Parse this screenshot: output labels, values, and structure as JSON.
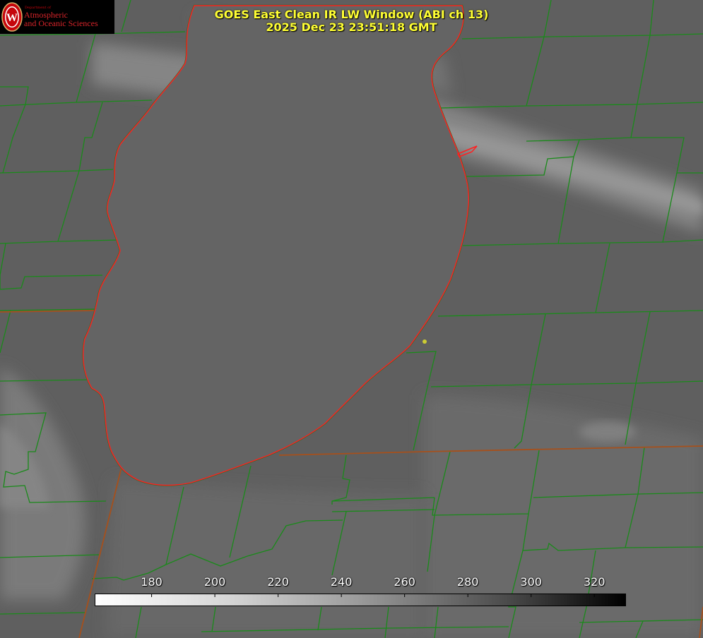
{
  "title": {
    "line1": "GOES East Clean IR LW Window (ABI ch 13)",
    "line2": "2025 Dec 23 23:51:18 GMT"
  },
  "logo": {
    "department": "Department of",
    "line1": "Atmospheric",
    "line2": "and Oceanic Sciences",
    "seal_letter": "W"
  },
  "colors": {
    "background_gray": "#5e5e5e",
    "county_lines": "#1a8a1a",
    "state_lines": "#b04a1a",
    "lake_outline": "#ff2020",
    "title_text": "#ffff33",
    "marker": "#cccc33"
  },
  "colorbar": {
    "ticks": [
      180,
      200,
      220,
      240,
      260,
      280,
      300,
      320
    ],
    "vmin": 162,
    "vmax": 330
  }
}
